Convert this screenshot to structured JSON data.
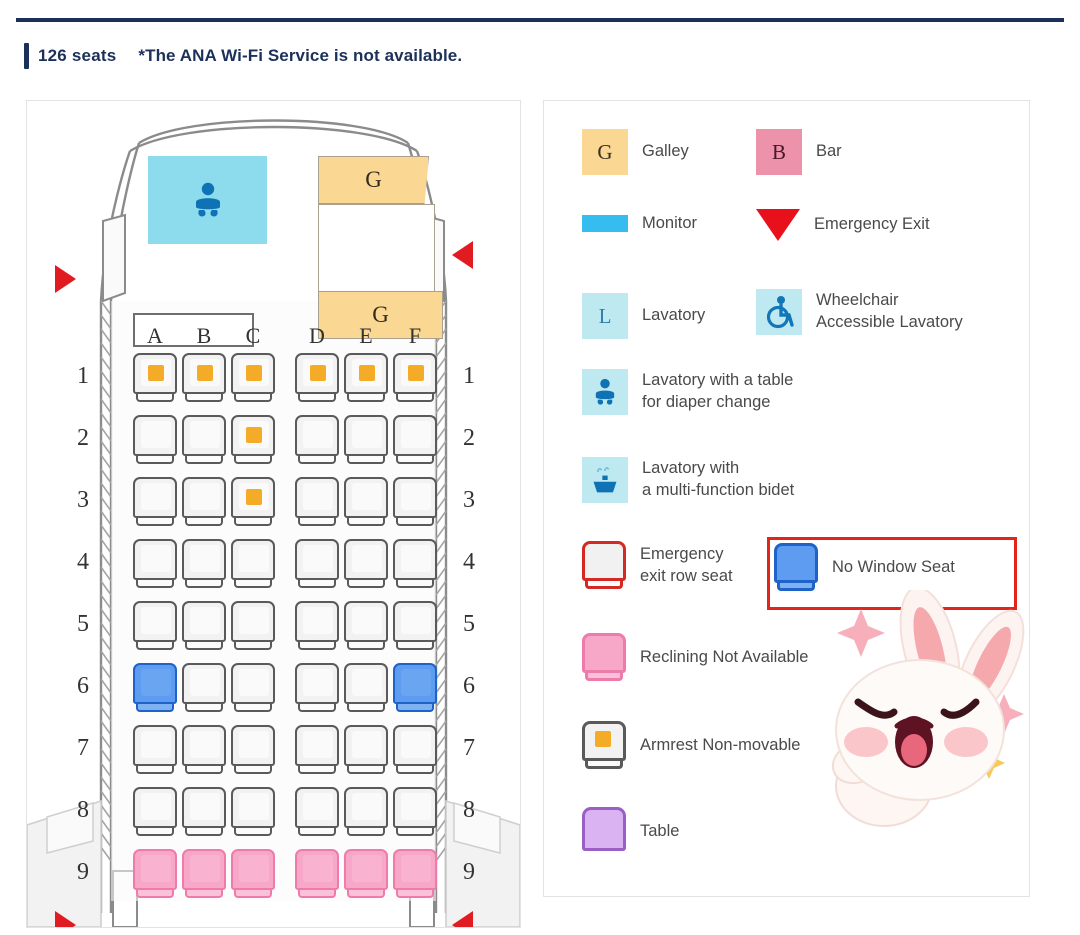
{
  "header": {
    "seat_count": "126 seats",
    "wifi_note": "*The ANA Wi-Fi Service is not available."
  },
  "seatmap": {
    "column_letters_left": [
      "A",
      "B",
      "C"
    ],
    "column_letters_right": [
      "D",
      "E",
      "F"
    ],
    "row_numbers": [
      "1",
      "2",
      "3",
      "4",
      "5",
      "6",
      "7",
      "8",
      "9"
    ],
    "galley_label_fwd": "G",
    "galley_label_aft": "G",
    "rows": [
      {
        "number": "1",
        "left": [
          "armrest",
          "armrest",
          "armrest"
        ],
        "right": [
          "armrest",
          "armrest",
          "armrest"
        ]
      },
      {
        "number": "2",
        "left": [
          "normal",
          "normal",
          "armrest"
        ],
        "right": [
          "normal",
          "normal",
          "normal"
        ]
      },
      {
        "number": "3",
        "left": [
          "normal",
          "normal",
          "armrest"
        ],
        "right": [
          "normal",
          "normal",
          "normal"
        ]
      },
      {
        "number": "4",
        "left": [
          "normal",
          "normal",
          "normal"
        ],
        "right": [
          "normal",
          "normal",
          "normal"
        ]
      },
      {
        "number": "5",
        "left": [
          "normal",
          "normal",
          "normal"
        ],
        "right": [
          "normal",
          "normal",
          "normal"
        ]
      },
      {
        "number": "6",
        "left": [
          "nowindow",
          "normal",
          "normal"
        ],
        "right": [
          "normal",
          "normal",
          "nowindow"
        ]
      },
      {
        "number": "7",
        "left": [
          "normal",
          "normal",
          "normal"
        ],
        "right": [
          "normal",
          "normal",
          "normal"
        ]
      },
      {
        "number": "8",
        "left": [
          "normal",
          "normal",
          "normal"
        ],
        "right": [
          "normal",
          "normal",
          "normal"
        ]
      },
      {
        "number": "9",
        "left": [
          "recline",
          "recline",
          "recline"
        ],
        "right": [
          "recline",
          "recline",
          "recline"
        ]
      }
    ]
  },
  "legend": {
    "items": [
      {
        "id": "galley",
        "icon": "galley-swatch",
        "glyph": "G",
        "label": "Galley"
      },
      {
        "id": "bar",
        "icon": "bar-swatch",
        "glyph": "B",
        "label": "Bar"
      },
      {
        "id": "monitor",
        "icon": "monitor-swatch",
        "glyph": "",
        "label": "Monitor"
      },
      {
        "id": "emergency-exit",
        "icon": "emergency-exit-triangle-icon",
        "glyph": "",
        "label": "Emergency Exit"
      },
      {
        "id": "lavatory",
        "icon": "lavatory-swatch",
        "glyph": "L",
        "label": "Lavatory"
      },
      {
        "id": "wheelchair-lav",
        "icon": "wheelchair-icon",
        "glyph": "",
        "label": "Wheelchair\nAccessible Lavatory"
      },
      {
        "id": "diaper-lav",
        "icon": "baby-icon",
        "glyph": "",
        "label": "Lavatory with a table\nfor diaper change"
      },
      {
        "id": "bidet-lav",
        "icon": "bidet-icon",
        "glyph": "",
        "label": "Lavatory with\na multi-function bidet"
      },
      {
        "id": "exit-row-seat",
        "icon": "exit-row-seat-icon",
        "glyph": "",
        "label": "Emergency\nexit row seat"
      },
      {
        "id": "no-window",
        "icon": "no-window-seat-icon",
        "glyph": "",
        "label": "No Window Seat"
      },
      {
        "id": "no-recline",
        "icon": "reclining-not-available-seat-icon",
        "glyph": "",
        "label": "Reclining Not Available"
      },
      {
        "id": "armrest-fixed",
        "icon": "armrest-non-movable-seat-icon",
        "glyph": "",
        "label": "Armrest Non-movable"
      },
      {
        "id": "table",
        "icon": "table-icon",
        "glyph": "",
        "label": "Table"
      }
    ]
  },
  "colors": {
    "navy": "#1c3159",
    "galley": "#fad793",
    "bar": "#ec93ab",
    "monitor": "#36bdef",
    "lavatory": "#bfe9f1",
    "exit_red": "#e8101b",
    "no_window_blue": "#5d9cf0",
    "no_recline_pink": "#f7a7c8",
    "armrest_orange": "#f4ab28",
    "table_purple": "#d9b3f2",
    "annotation_red": "#e1251b"
  }
}
